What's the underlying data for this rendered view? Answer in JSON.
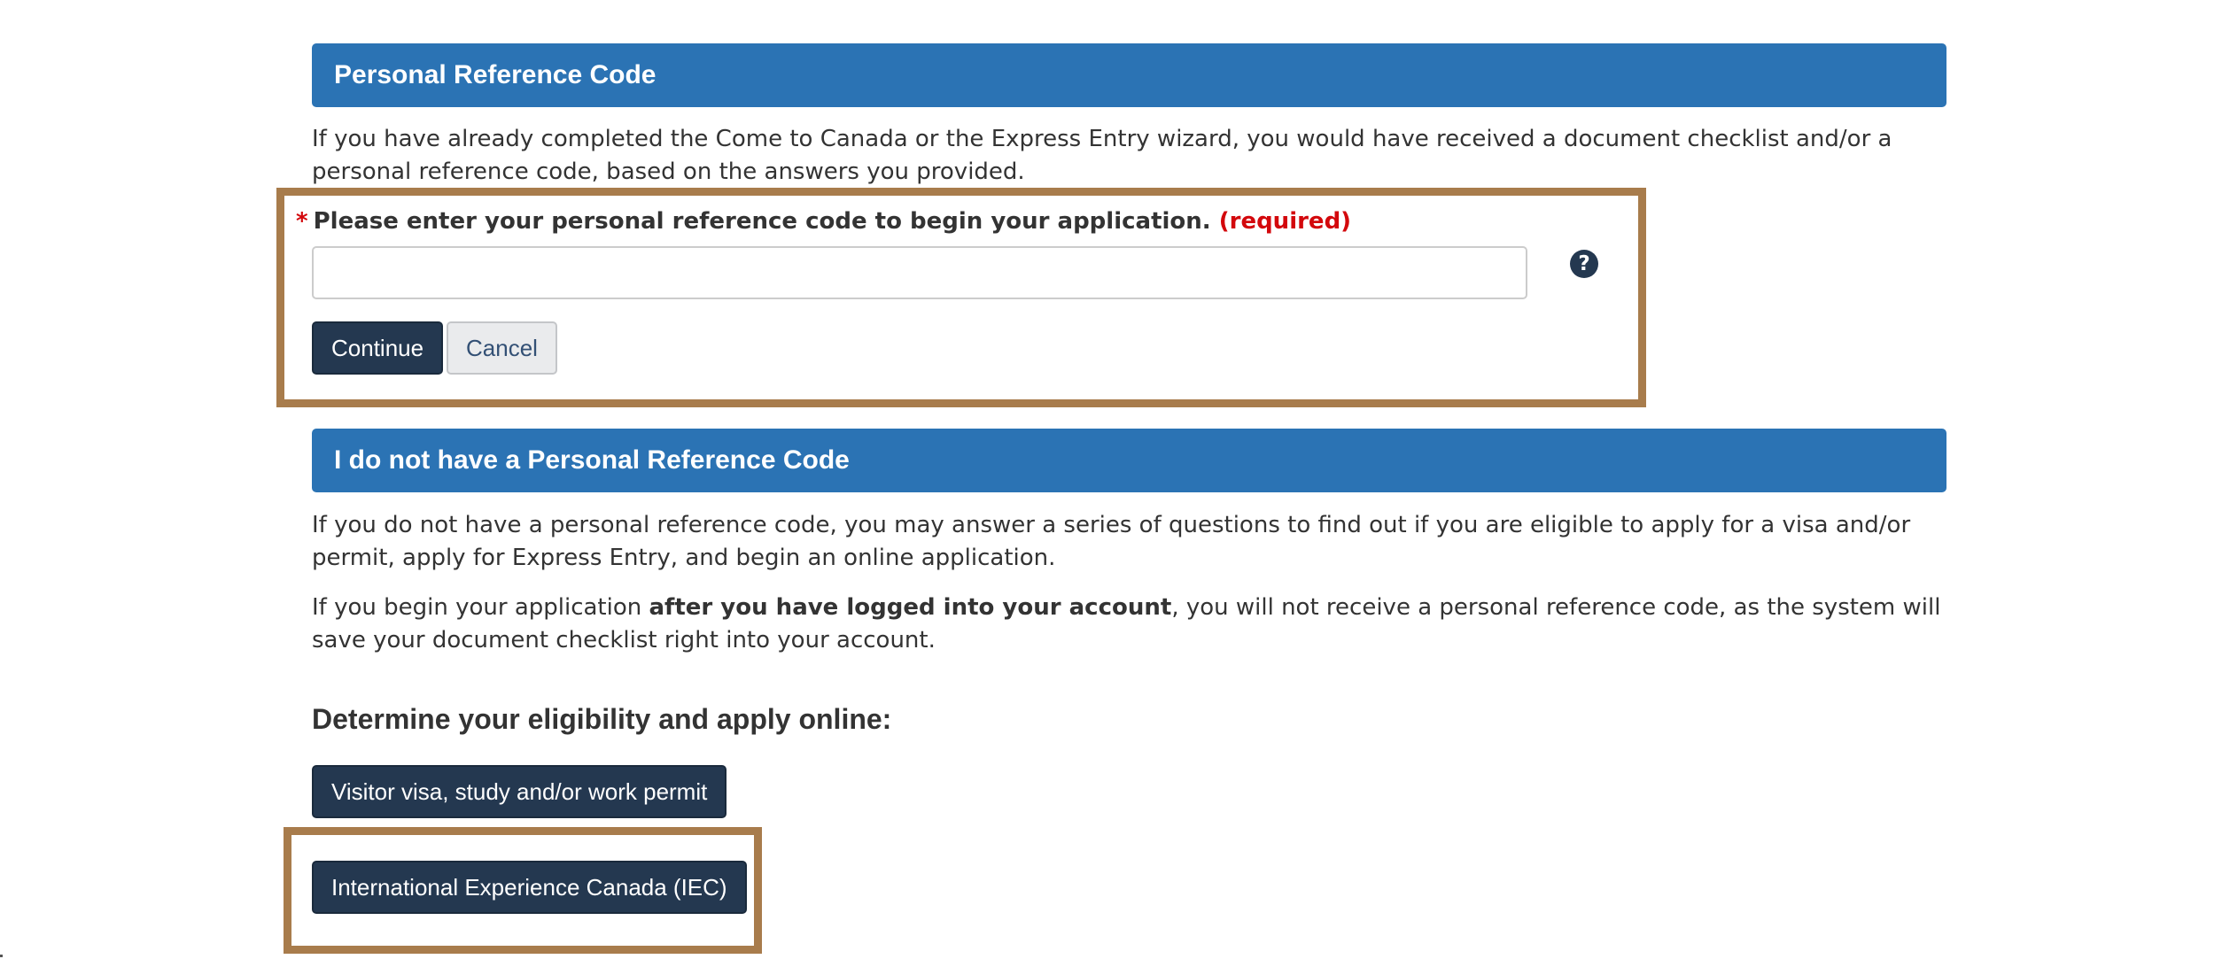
{
  "personal_reference": {
    "header": "Personal Reference Code",
    "intro": "If you have already completed the Come to Canada or the Express Entry wizard, you would have received a document checklist and/or a personal reference code, based on the answers you provided.",
    "field_required_marker": "*",
    "field_label": "Please enter your personal reference code to begin your application.",
    "field_required_text": "(required)",
    "input_value": "",
    "help_icon_glyph": "?",
    "continue_label": "Continue",
    "cancel_label": "Cancel"
  },
  "no_reference": {
    "header": "I do not have a Personal Reference Code",
    "paragraph1": "If you do not have a personal reference code, you may answer a series of questions to find out if you are eligible to apply for a visa and/or permit, apply for Express Entry, and begin an online application.",
    "paragraph2_before": "If you begin your application ",
    "paragraph2_bold": "after you have logged into your account",
    "paragraph2_after": ", you will not receive a personal reference code, as the system will save your document checklist right into your account.",
    "eligibility_heading": "Determine your eligibility and apply online:",
    "visitor_button_label": "Visitor visa, study and/or work permit",
    "iec_button_label": "International Experience Canada (IEC)"
  },
  "icons": {
    "help": "question-circle-icon"
  },
  "colors": {
    "header_blue": "#2b73b4",
    "primary_button": "#243850",
    "required_red": "#d3080c",
    "highlight_border": "#a87c4c"
  }
}
